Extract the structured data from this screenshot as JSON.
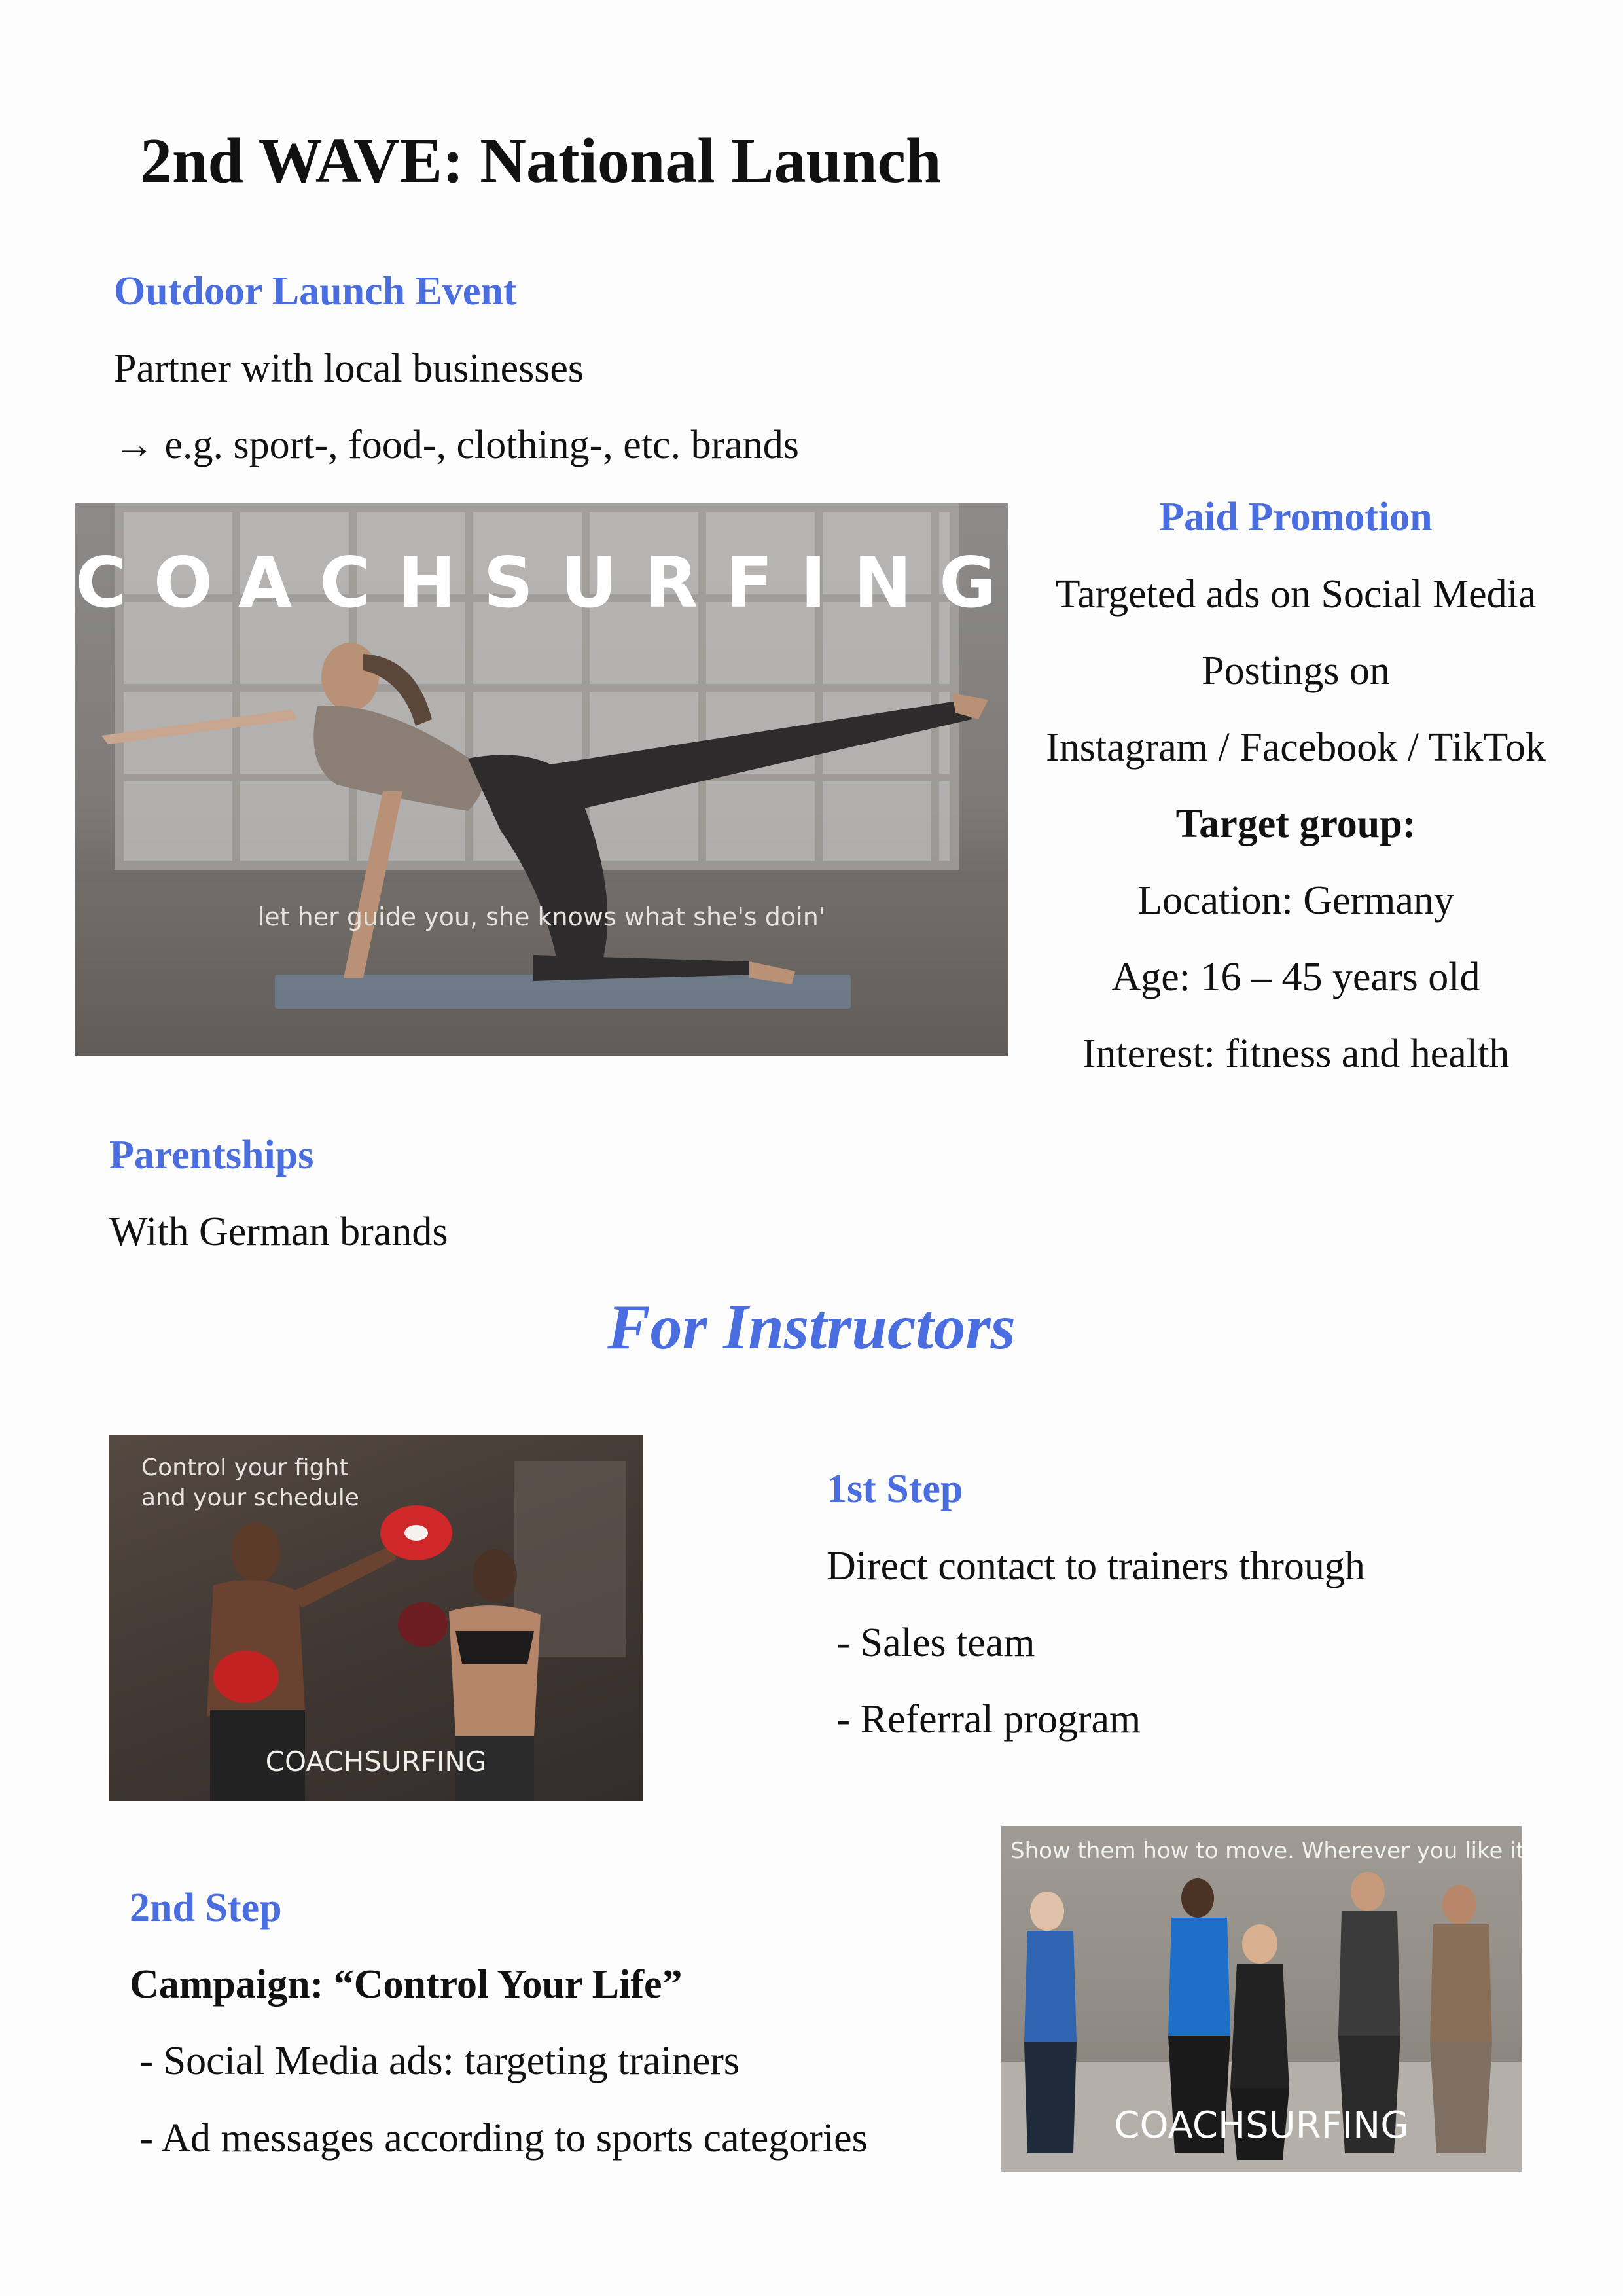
{
  "page": {
    "title": "2nd WAVE: National Launch"
  },
  "outdoor": {
    "heading": "Outdoor Launch Event",
    "line1": "Partner with local businesses",
    "line2": "→ e.g. sport-, food-, clothing-, etc. brands"
  },
  "yoga_image": {
    "brand": "COACHSURFING",
    "tagline": "let her guide you, she knows what she's doin'"
  },
  "paid": {
    "heading": "Paid Promotion",
    "lines": [
      "Targeted ads on Social Media",
      "Postings on",
      "Instagram / Facebook / TikTok"
    ],
    "target_heading": "Target group:",
    "location": "Location: Germany",
    "age": "Age: 16 – 45 years old",
    "interest": "Interest: fitness and health"
  },
  "parentships": {
    "heading": "Parentships",
    "text": "With German brands"
  },
  "instructors": {
    "heading": "For Instructors"
  },
  "boxing_image": {
    "tag_line1": "Control your fight",
    "tag_line2": "and your schedule",
    "brand": "COACHSURFING"
  },
  "step1": {
    "heading": "1st Step",
    "line1": "Direct contact to trainers through",
    "item1": " - Sales team",
    "item2": " - Referral program"
  },
  "step2": {
    "heading": "2nd Step",
    "campaign": "Campaign: “Control Your Life”",
    "item1": " - Social Media ads: targeting trainers",
    "item2": " - Ad messages according to sports categories"
  },
  "dance_image": {
    "tag": "Show them how to move. Wherever you like it",
    "brand": "COACHSURFING"
  },
  "colors": {
    "accent": "#4a6ee0",
    "text": "#111111",
    "background": "#fdfdfd"
  }
}
